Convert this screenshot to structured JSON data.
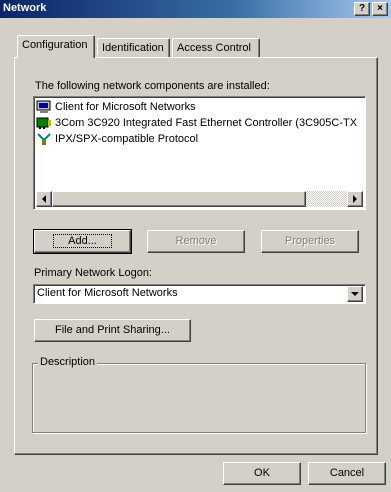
{
  "window": {
    "title": "Network"
  },
  "caption": {
    "help_label": "?",
    "close_label": "×"
  },
  "tabs": [
    {
      "label": "Configuration"
    },
    {
      "label": "Identification"
    },
    {
      "label": "Access Control"
    }
  ],
  "components": {
    "label": "The following network components are installed:",
    "items": [
      {
        "label": "Client for Microsoft Networks",
        "icon": "client-icon"
      },
      {
        "label": "3Com 3C920 Integrated Fast Ethernet Controller (3C905C-TX",
        "icon": "network-adapter-icon"
      },
      {
        "label": "IPX/SPX-compatible Protocol",
        "icon": "protocol-icon"
      }
    ]
  },
  "buttons": {
    "add": "Add...",
    "remove": "Remove",
    "properties": "Properties",
    "file_print_sharing": "File and Print Sharing...",
    "ok": "OK",
    "cancel": "Cancel"
  },
  "logon": {
    "label": "Primary Network Logon:",
    "value": "Client for Microsoft Networks"
  },
  "description": {
    "label": "Description"
  },
  "colors": {
    "titlebar": "#0a246a",
    "face": "#d4d0c8"
  }
}
